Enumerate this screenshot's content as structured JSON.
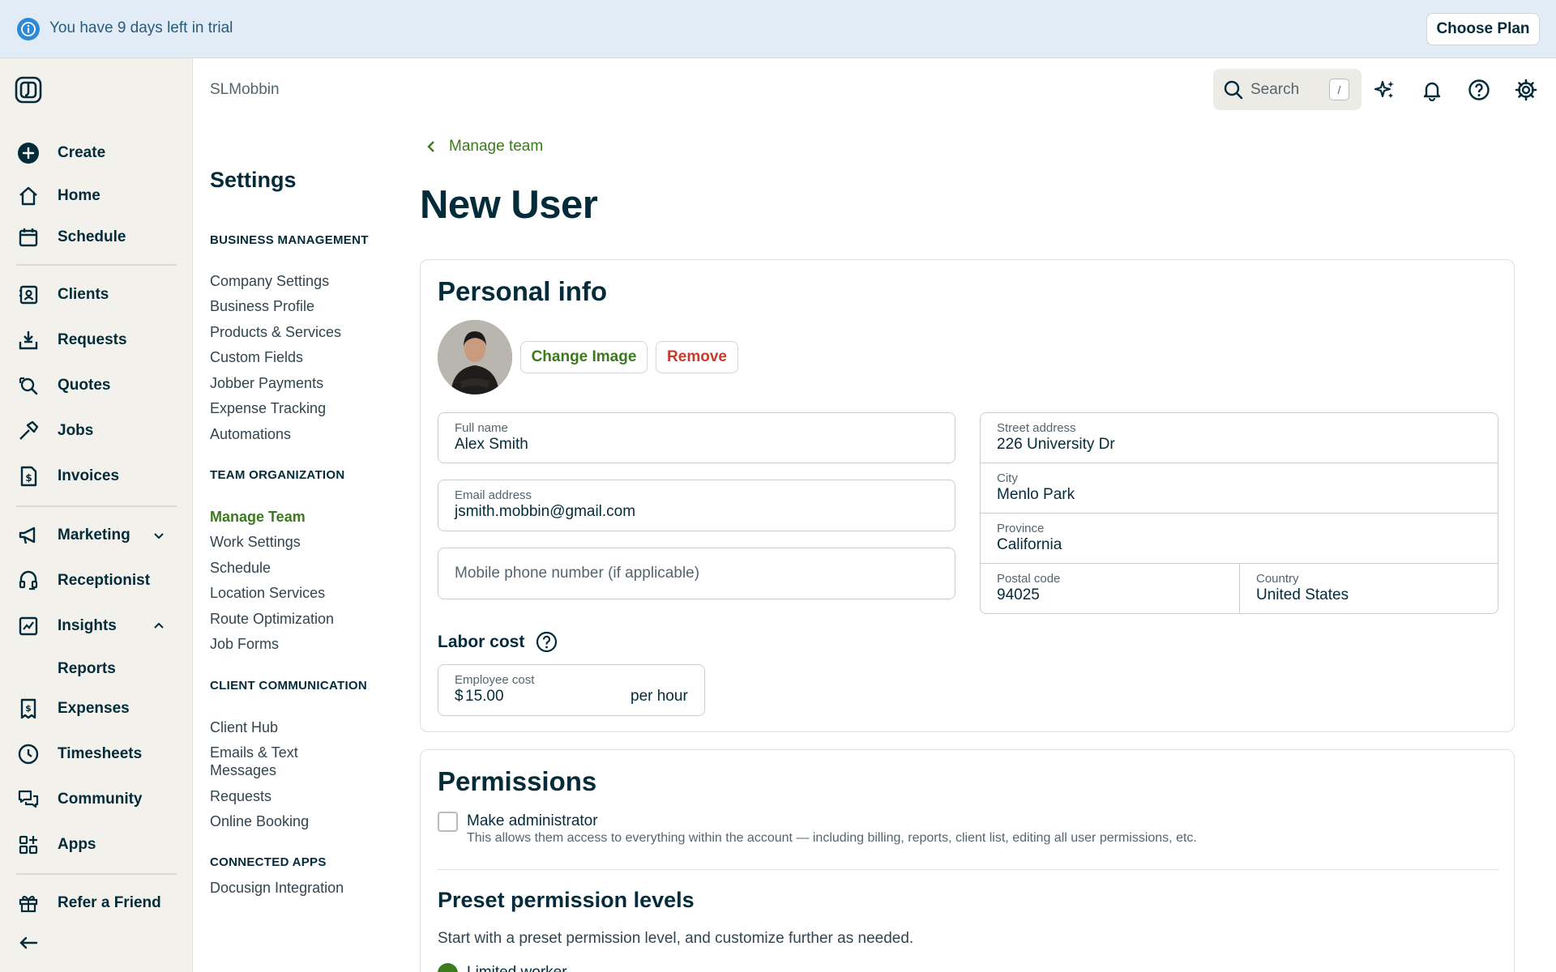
{
  "banner": {
    "text": "You have 9 days left in trial",
    "cta": "Choose Plan"
  },
  "sidebar": {
    "items": [
      {
        "label": "Create"
      },
      {
        "label": "Home"
      },
      {
        "label": "Schedule"
      },
      {
        "label": "Clients"
      },
      {
        "label": "Requests"
      },
      {
        "label": "Quotes"
      },
      {
        "label": "Jobs"
      },
      {
        "label": "Invoices"
      },
      {
        "label": "Marketing"
      },
      {
        "label": "Receptionist"
      },
      {
        "label": "Insights"
      },
      {
        "label": "Reports"
      },
      {
        "label": "Expenses"
      },
      {
        "label": "Timesheets"
      },
      {
        "label": "Community"
      },
      {
        "label": "Apps"
      },
      {
        "label": "Refer a Friend"
      }
    ]
  },
  "topbar": {
    "account": "SLMobbin",
    "search_placeholder": "Search",
    "search_shortcut": "/"
  },
  "settings": {
    "title": "Settings",
    "sections": [
      {
        "title": "BUSINESS MANAGEMENT",
        "links": [
          "Company Settings",
          "Business Profile",
          "Products & Services",
          "Custom Fields",
          "Jobber Payments",
          "Expense Tracking",
          "Automations"
        ]
      },
      {
        "title": "TEAM ORGANIZATION",
        "links": [
          "Manage Team",
          "Work Settings",
          "Schedule",
          "Location Services",
          "Route Optimization",
          "Job Forms"
        ]
      },
      {
        "title": "CLIENT COMMUNICATION",
        "links": [
          "Client Hub",
          "Emails & Text Messages",
          "Requests",
          "Online Booking"
        ]
      },
      {
        "title": "CONNECTED APPS",
        "links": [
          "Docusign Integration"
        ]
      }
    ]
  },
  "main": {
    "back_label": "Manage team",
    "title": "New User",
    "personal": {
      "title": "Personal info",
      "change_image": "Change Image",
      "remove": "Remove",
      "full_name": {
        "label": "Full name",
        "value": "Alex Smith"
      },
      "email": {
        "label": "Email address",
        "value": "jsmith.mobbin@gmail.com"
      },
      "phone_placeholder": "Mobile phone number (if applicable)",
      "street": {
        "label": "Street address",
        "value": "226 University Dr"
      },
      "city": {
        "label": "City",
        "value": "Menlo Park"
      },
      "province": {
        "label": "Province",
        "value": "California"
      },
      "postal": {
        "label": "Postal code",
        "value": "94025"
      },
      "country": {
        "label": "Country",
        "value": "United States"
      },
      "labor_title": "Labor cost",
      "employee_cost": {
        "label": "Employee cost",
        "currency": "$",
        "value": "15.00",
        "unit": "per hour"
      }
    },
    "permissions": {
      "title": "Permissions",
      "admin_label": "Make administrator",
      "admin_desc": "This allows them access to everything within the account — including billing, reports, client list, editing all user permissions, etc.",
      "preset_title": "Preset permission levels",
      "preset_desc": "Start with a preset permission level, and customize further as needed.",
      "preset_first": "Limited worker"
    }
  },
  "colors": {
    "brand_green": "#3c7a1e",
    "navy": "#032b3a",
    "banner_bg": "#e1ecf7",
    "info_blue": "#2f8ad6",
    "danger_red": "#c93a2e",
    "sidebar_bg": "#f3f1ec"
  }
}
